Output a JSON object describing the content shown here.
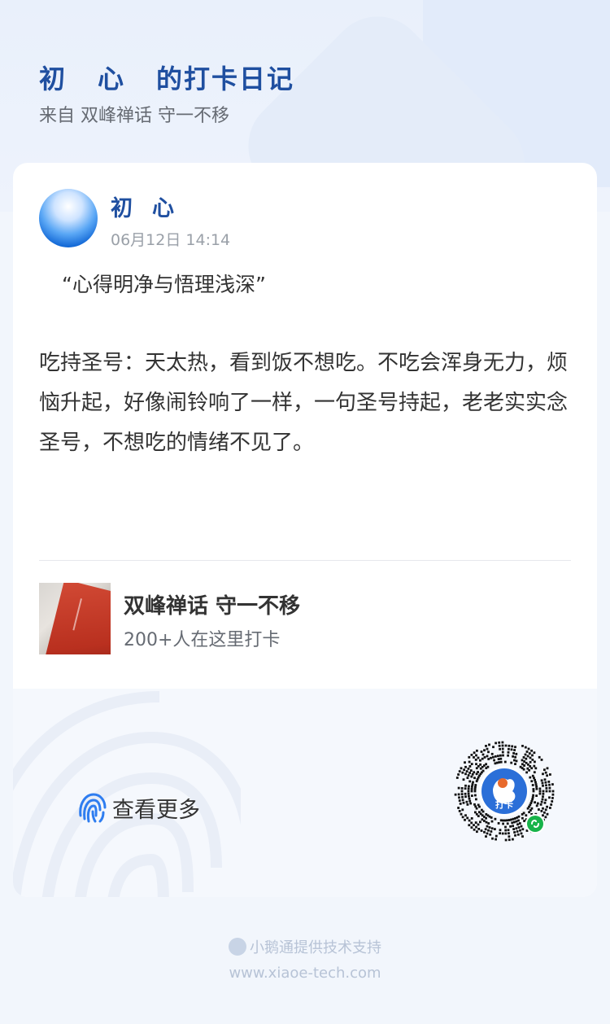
{
  "header": {
    "title_name": "初　心",
    "title_suffix": "的打卡日记",
    "subtitle": "来自 双峰禅话 守一不移"
  },
  "post": {
    "user_name_first": "初",
    "user_name_second": "心",
    "time": "06月12日 14:14",
    "quote": "“心得明净与悟理浅深”",
    "body": "吃持圣号：天太热，看到饭不想吃。不吃会浑身无力，烦恼升起，好像闹铃响了一样，一句圣号持起，老老实实念圣号，不想吃的情绪不见了。"
  },
  "group": {
    "name": "双峰禅话 守一不移",
    "count": "200+人在这里打卡"
  },
  "actions": {
    "more_label": "查看更多"
  },
  "qr": {
    "center_label": "打卡"
  },
  "footer": {
    "provider": "小鹅通提供技术支持",
    "url": "www.xiaoe-tech.com"
  },
  "colors": {
    "accent": "#1f4fa0",
    "accent_light": "#2e7df0",
    "background": "#f2f6fc"
  }
}
